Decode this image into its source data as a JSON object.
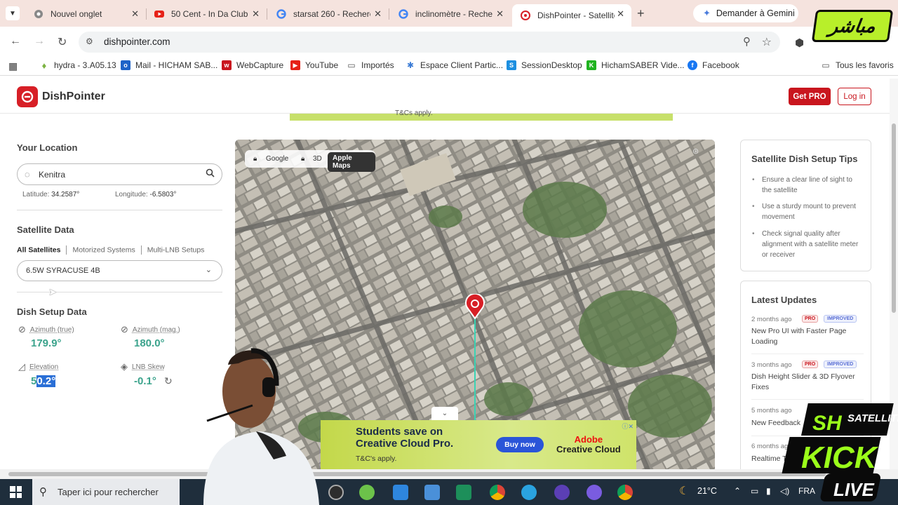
{
  "browser": {
    "tabs": [
      {
        "title": "Nouvel onglet",
        "icon": "chrome-icon"
      },
      {
        "title": "50 Cent - In Da Club",
        "icon": "youtube-icon"
      },
      {
        "title": "starsat 260 - Recherche",
        "icon": "google-icon"
      },
      {
        "title": "inclinomètre - Recherche",
        "icon": "google-icon"
      },
      {
        "title": "DishPointer - Satellite",
        "icon": "dishpointer-icon"
      }
    ],
    "gemini": "Demander à Gemini",
    "url": "dishpointer.com",
    "bookmarks": [
      {
        "label": "hydra - 3.A05.13"
      },
      {
        "label": "Mail - HICHAM SAB..."
      },
      {
        "label": "WebCapture"
      },
      {
        "label": "YouTube"
      },
      {
        "label": "Importés"
      },
      {
        "label": "Espace Client Partic..."
      },
      {
        "label": "SessionDesktop"
      },
      {
        "label": "HichamSABER Vide..."
      },
      {
        "label": "Facebook"
      }
    ],
    "all_bookmarks": "Tous les favoris"
  },
  "site": {
    "brand": "DishPointer",
    "get_pro": "Get PRO",
    "login": "Log in",
    "top_ad_text": "T&Cs apply."
  },
  "location": {
    "heading": "Your Location",
    "search_value": "Kenitra",
    "latitude_label": "Latitude:",
    "latitude": "34.2587°",
    "longitude_label": "Longitude:",
    "longitude": "-6.5803°"
  },
  "satellite": {
    "heading": "Satellite Data",
    "tabs": [
      "All Satellites",
      "Motorized Systems",
      "Multi-LNB Setups"
    ],
    "selected": "6.5W SYRACUSE 4B"
  },
  "setup": {
    "heading": "Dish Setup Data",
    "azimuth_true_label": "Azimuth (true)",
    "azimuth_true": "179.9°",
    "azimuth_mag_label": "Azimuth (mag.)",
    "azimuth_mag": "180.0°",
    "elevation_label": "Elevation",
    "elevation_prefix": "5",
    "elevation_selected": "0.2°",
    "lnb_label": "LNB Skew",
    "lnb": "-0.1°"
  },
  "map": {
    "controls": [
      "Google",
      "3D",
      "Apple Maps"
    ]
  },
  "tips": {
    "heading": "Satellite Dish Setup Tips",
    "items": [
      "Ensure a clear line of sight to the satellite",
      "Use a sturdy mount to prevent movement",
      "Check signal quality after alignment with a satellite meter or receiver"
    ]
  },
  "updates": {
    "heading": "Latest Updates",
    "items": [
      {
        "date": "2 months ago",
        "title": "New Pro UI with Faster Page Loading",
        "pro": "PRO",
        "tag": "IMPROVED"
      },
      {
        "date": "3 months ago",
        "title": "Dish Height Slider & 3D Flyover Fixes",
        "pro": "PRO",
        "tag": "IMPROVED"
      },
      {
        "date": "5 months ago",
        "title": "New Feedback"
      },
      {
        "date": "6 months ago",
        "title": "Realtime T"
      }
    ]
  },
  "ad": {
    "headline1": "Students save on",
    "headline2": "Creative Cloud Pro.",
    "tc": "T&C's apply.",
    "buy": "Buy now",
    "brand1": "Adobe",
    "brand2": "Creative Cloud"
  },
  "taskbar": {
    "search_placeholder": "Taper ici pour rechercher",
    "weather": "21°C",
    "lang": "FRA"
  },
  "overlay": {
    "mubasher": "مباشر",
    "kick_sh": "SH",
    "kick_satellite": "SATELLITE",
    "kick": "KICK",
    "live": "LIVE"
  }
}
